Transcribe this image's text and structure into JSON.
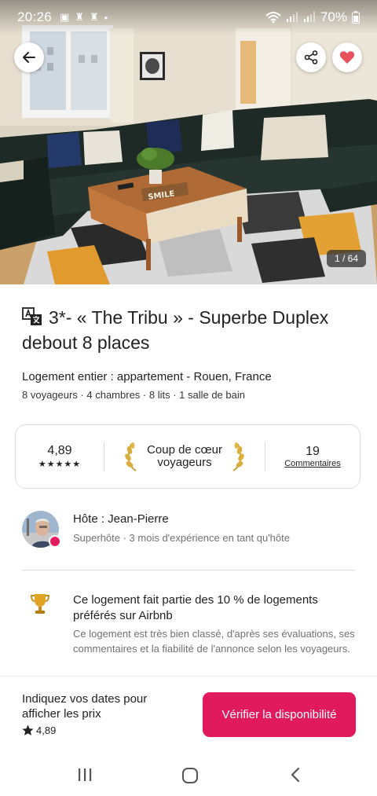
{
  "status_bar": {
    "time": "20:26",
    "battery": "70%"
  },
  "photo": {
    "counter": "1 / 64",
    "sign_text": "SMILE"
  },
  "listing": {
    "title": "3*- « The Tribu » - Superbe Duplex debout 8 places",
    "subtitle": "Logement entier : appartement - Rouen, France",
    "details": "8 voyageurs · 4 chambres · 8 lits · 1 salle de bain"
  },
  "stats": {
    "rating": "4,89",
    "stars": "★★★★★",
    "favorite_line1": "Coup de cœur",
    "favorite_line2": "voyageurs",
    "reviews_count": "19",
    "reviews_label": "Commentaires"
  },
  "host": {
    "name": "Hôte : Jean-Pierre",
    "subtitle": "Superhôte · 3 mois d'expérience en tant qu'hôte"
  },
  "highlight": {
    "title": "Ce logement fait partie des 10 % de logements préférés sur Airbnb",
    "body": "Ce logement est très bien classé, d'après ses évaluations, ses commentaires et la fiabilité de l'annonce selon les voyageurs."
  },
  "bottom_bar": {
    "dates_prompt": "Indiquez vos dates pour afficher les prix",
    "rating": "4,89",
    "check_button": "Vérifier la disponibilité"
  },
  "colors": {
    "accent": "#e01a5c",
    "text": "#222222",
    "muted": "#717171",
    "border": "#dddddd"
  },
  "icons": [
    "back-arrow-icon",
    "share-icon",
    "heart-icon",
    "translate-icon",
    "laurel-left-icon",
    "laurel-right-icon",
    "trophy-icon",
    "star-icon",
    "recents-icon",
    "home-icon",
    "back-nav-icon"
  ]
}
